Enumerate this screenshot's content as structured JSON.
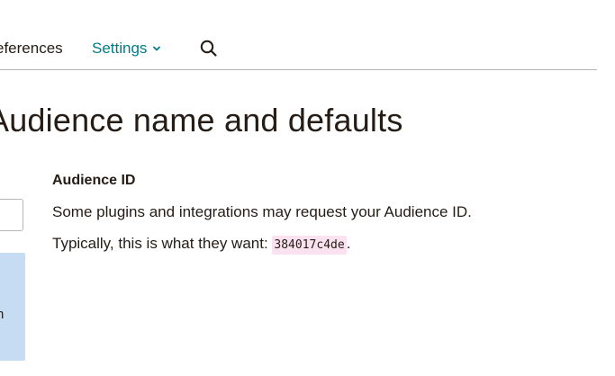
{
  "nav": {
    "preferences_label": "Preferences",
    "settings_label": "Settings",
    "search_icon": "search-icon",
    "chevron_icon": "chevron-down-icon"
  },
  "page": {
    "title": "Audience name and defaults"
  },
  "left_panel": {
    "text_fragment": "n"
  },
  "audience_id": {
    "label": "Audience ID",
    "description": "Some plugins and integrations may request your Audience ID.",
    "typical_prefix": "Typically, this is what they want: ",
    "id_value": "384017c4de",
    "typical_suffix": "."
  },
  "colors": {
    "accent": "#007c89",
    "text": "#241c15",
    "divider": "#b7b7b7",
    "info_panel": "#c6dcf2",
    "code_bg": "#fbe2f0"
  }
}
